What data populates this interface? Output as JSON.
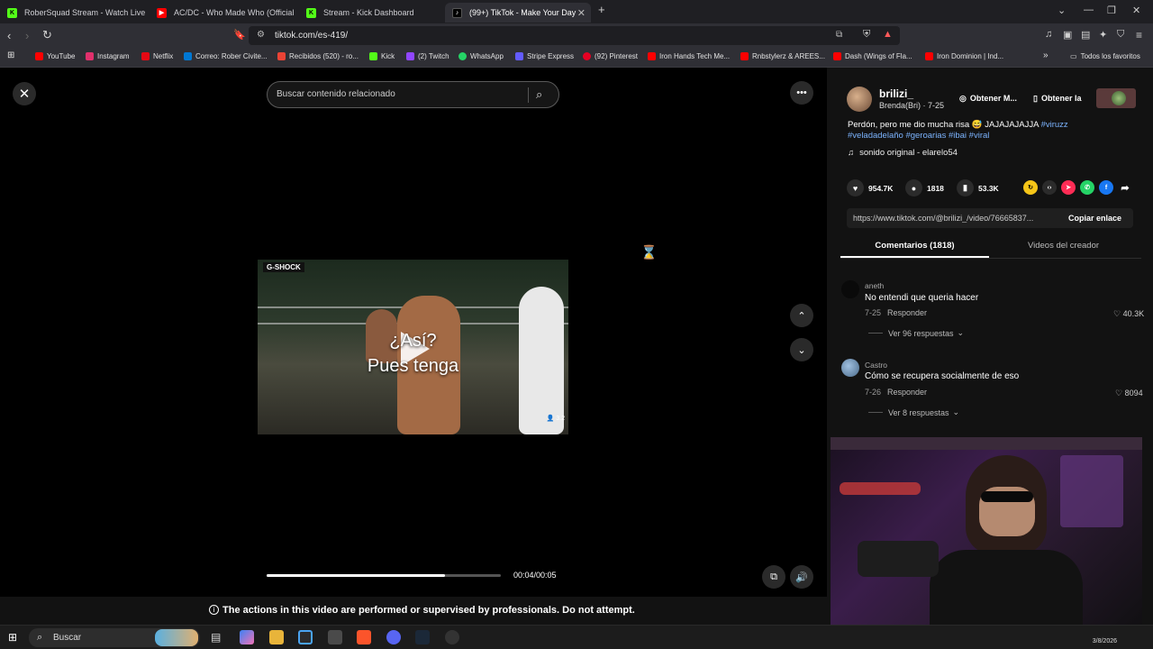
{
  "tabs": [
    {
      "title": "RoberSquad Stream - Watch Live",
      "favicon_color": "#53fc18"
    },
    {
      "title": "AC/DC - Who Made Who (Official HD",
      "favicon_color": "#ff0000"
    },
    {
      "title": "Stream - Kick Dashboard",
      "favicon_color": "#53fc18"
    },
    {
      "title": "(99+) TikTok - Make Your Day",
      "favicon_color": "#ffffff"
    }
  ],
  "address": {
    "url": "tiktok.com/es-419/"
  },
  "bookmarks": [
    {
      "label": "YouTube",
      "color": "#ff0000"
    },
    {
      "label": "Instagram",
      "color": "#e1306c"
    },
    {
      "label": "Netflix",
      "color": "#e50914"
    },
    {
      "label": "Correo: Rober Civite...",
      "color": "#0078d4"
    },
    {
      "label": "Recibidos (520) - ro...",
      "color": "#ea4335"
    },
    {
      "label": "Kick",
      "color": "#53fc18"
    },
    {
      "label": "(2) Twitch",
      "color": "#9146ff"
    },
    {
      "label": "WhatsApp",
      "color": "#25d366"
    },
    {
      "label": "Stripe Express",
      "color": "#635bff"
    },
    {
      "label": "(92) Pinterest",
      "color": "#e60023"
    },
    {
      "label": "Iron Hands Tech Me...",
      "color": "#ff0000"
    },
    {
      "label": "Rnbstylerz & AREES...",
      "color": "#ff0000"
    },
    {
      "label": "Dash (Wings of Fla...",
      "color": "#ff0000"
    },
    {
      "label": "Iron Dominion | Ind...",
      "color": "#ff0000"
    }
  ],
  "bookmarks_all": "Todos los favoritos",
  "search": {
    "placeholder": "Buscar contenido relacionado"
  },
  "video": {
    "caption_line1": "¿Así?",
    "caption_line2": "Pues tenga",
    "badge": "G-SHOCK",
    "viewers": "3.2",
    "time": "00:04/00:05",
    "progress": 0.76
  },
  "disclaimer": "The actions in this video are performed or supervised by professionals. Do not attempt.",
  "creator": {
    "username": "brilizi_",
    "subtitle": "Brenda(Bri) · 7-25",
    "chip1": "Obtener M...",
    "chip2": "Obtener la",
    "description": "Perdón, pero me dio mucha risa 😅 JAJAJAJAJJA",
    "tags": "#viruzz",
    "tags2": "#veladadelaño #geroarias #ibai #viral",
    "sound": "sonido original - elarelo54"
  },
  "stats": {
    "likes": "954.7K",
    "comments": "1818",
    "saves": "53.3K"
  },
  "link": {
    "url": "https://www.tiktok.com/@brilizi_/video/76665837...",
    "copy_label": "Copiar enlace"
  },
  "panel_tabs": {
    "comments": "Comentarios (1818)",
    "creator_videos": "Videos del creador"
  },
  "comments": [
    {
      "name": "aneth",
      "text": "No entendi que queria hacer",
      "date": "7-25",
      "reply": "Responder",
      "likes": "40.3K",
      "more": "Ver 96 respuestas"
    },
    {
      "name": "Castro",
      "text": "Cómo se recupera socialmente de eso",
      "date": "7-26",
      "reply": "Responder",
      "likes": "8094",
      "more": "Ver 8 respuestas"
    }
  ],
  "taskbar": {
    "search": "Buscar",
    "date": "3/8/2026"
  }
}
